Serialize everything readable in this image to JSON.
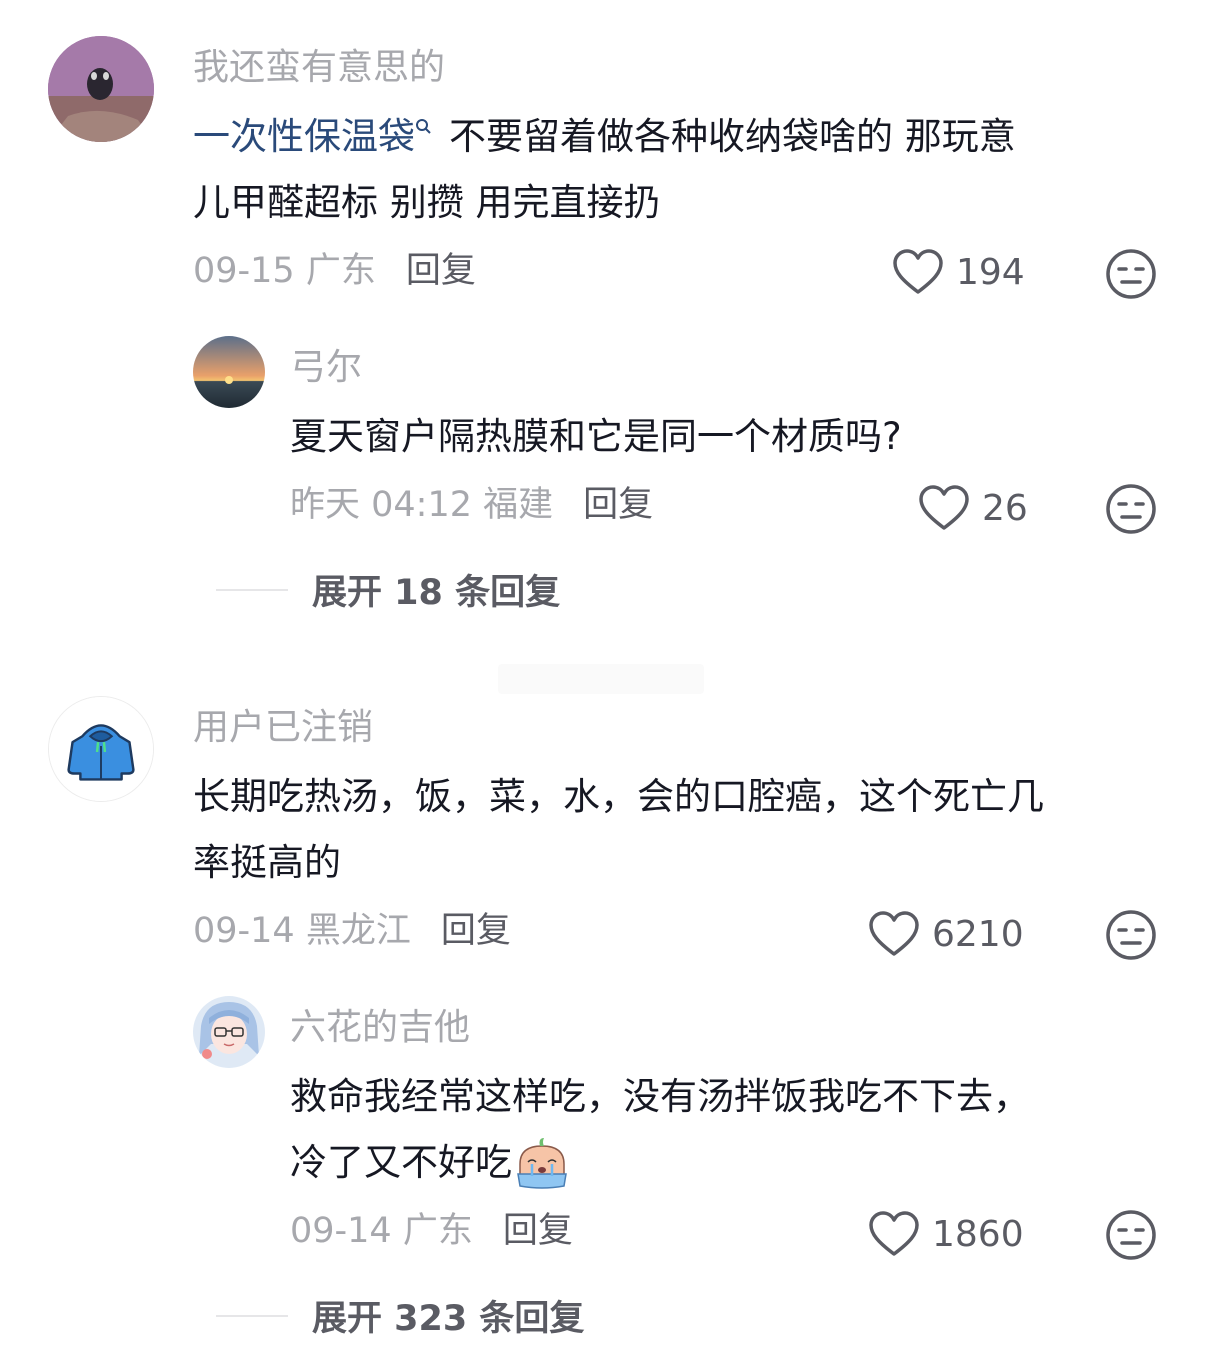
{
  "comments": [
    {
      "username": "我还蛮有意思的",
      "keyword": "一次性保温袋",
      "text_line1": "不要留着做各种收纳袋啥的 那玩意",
      "text_line2": "儿甲醛超标 别攒 用完直接扔",
      "time": "09-15 广东",
      "reply_label": "回复",
      "likes": "194"
    },
    {
      "username": "弓尔",
      "text_line1": "夏天窗户隔热膜和它是同一个材质吗?",
      "time": "昨天 04:12 福建",
      "reply_label": "回复",
      "likes": "26"
    },
    {
      "expand_label": "展开 18 条回复"
    },
    {
      "username": "用户已注销",
      "text_line1": "长期吃热汤，饭，菜，水，会的口腔癌，这个死亡几",
      "text_line2": "率挺高的",
      "time": "09-14 黑龙江",
      "reply_label": "回复",
      "likes": "6210"
    },
    {
      "username": "六花的吉他",
      "text_line1": "救命我经常这样吃，没有汤拌饭我吃不下去，",
      "text_line2": "冷了又不好吃",
      "time": "09-14 广东",
      "reply_label": "回复",
      "likes": "1860"
    },
    {
      "expand_label": "展开 323 条回复"
    }
  ],
  "colors": {
    "username": "#a7a8ad",
    "body": "#161823",
    "keyword_link": "#2a4a7a",
    "meta_secondary": "#5a5b63"
  },
  "icons": {
    "like": "heart-outline-icon",
    "dislike": "meh-face-icon",
    "search": "search-icon"
  }
}
